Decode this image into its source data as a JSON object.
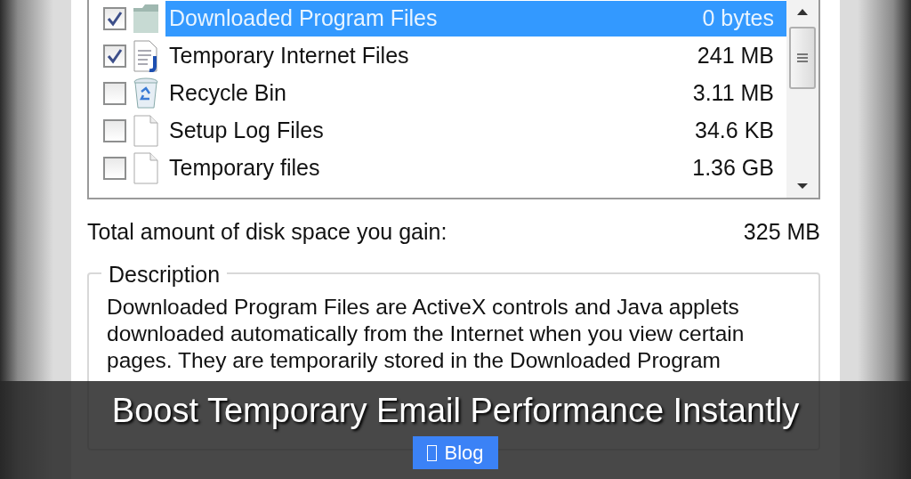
{
  "file_list": {
    "items": [
      {
        "name": "Downloaded Program Files",
        "size": "0 bytes",
        "checked": true,
        "selected": true,
        "kind": "folder"
      },
      {
        "name": "Temporary Internet Files",
        "size": "241 MB",
        "checked": true,
        "selected": false,
        "kind": "webdoc"
      },
      {
        "name": "Recycle Bin",
        "size": "3.11 MB",
        "checked": false,
        "selected": false,
        "kind": "bin"
      },
      {
        "name": "Setup Log Files",
        "size": "34.6 KB",
        "checked": false,
        "selected": false,
        "kind": "page"
      },
      {
        "name": "Temporary files",
        "size": "1.36 GB",
        "checked": false,
        "selected": false,
        "kind": "page"
      }
    ]
  },
  "total": {
    "label": "Total amount of disk space you gain:",
    "value": "325 MB"
  },
  "description": {
    "title": "Description",
    "text": "Downloaded Program Files are ActiveX controls and Java applets downloaded automatically from the Internet when you view certain pages. They are temporarily stored in the Downloaded Program"
  },
  "banner": {
    "title": "Boost Temporary Email Performance Instantly",
    "tag": "Blog"
  }
}
